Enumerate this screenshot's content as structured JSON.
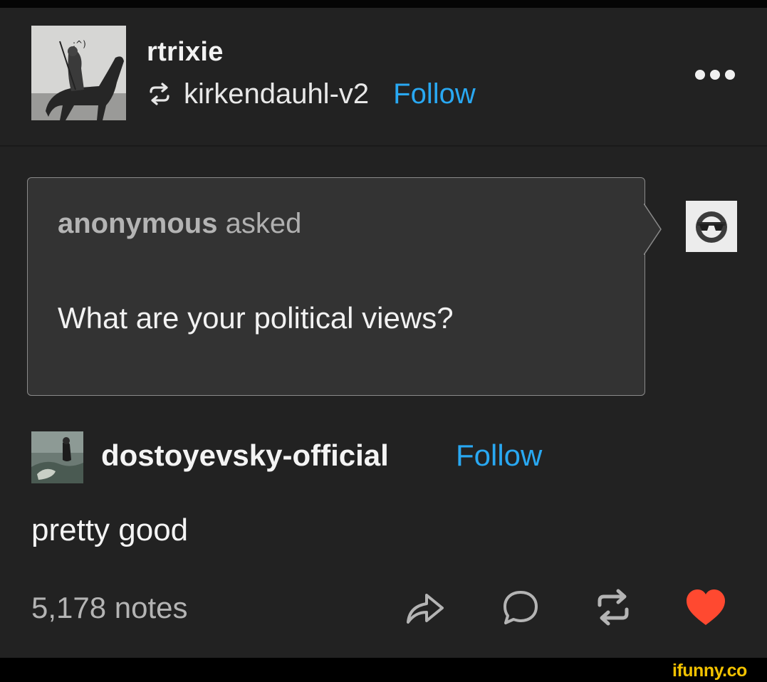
{
  "post": {
    "author": "rtrixie",
    "reblogged_from": "kirkendauhl-v2",
    "reblogged_follow_label": "Follow",
    "avatar_caption": ":^)",
    "ask": {
      "asker": "anonymous",
      "asked_label": "asked",
      "question": "What are your political views?"
    },
    "answer": {
      "author": "dostoyevsky-official",
      "follow_label": "Follow",
      "text": "pretty good"
    },
    "footer": {
      "notes": "5,178 notes"
    }
  },
  "watermark": "ifunny.co",
  "colors": {
    "background": "#222222",
    "accent_blue": "#29a8f2",
    "like_red": "#ff4930",
    "ask_box": "#333333"
  },
  "icons": [
    "more-icon",
    "reblog-icon",
    "share-icon",
    "reply-icon",
    "reblog-action-icon",
    "heart-icon"
  ]
}
